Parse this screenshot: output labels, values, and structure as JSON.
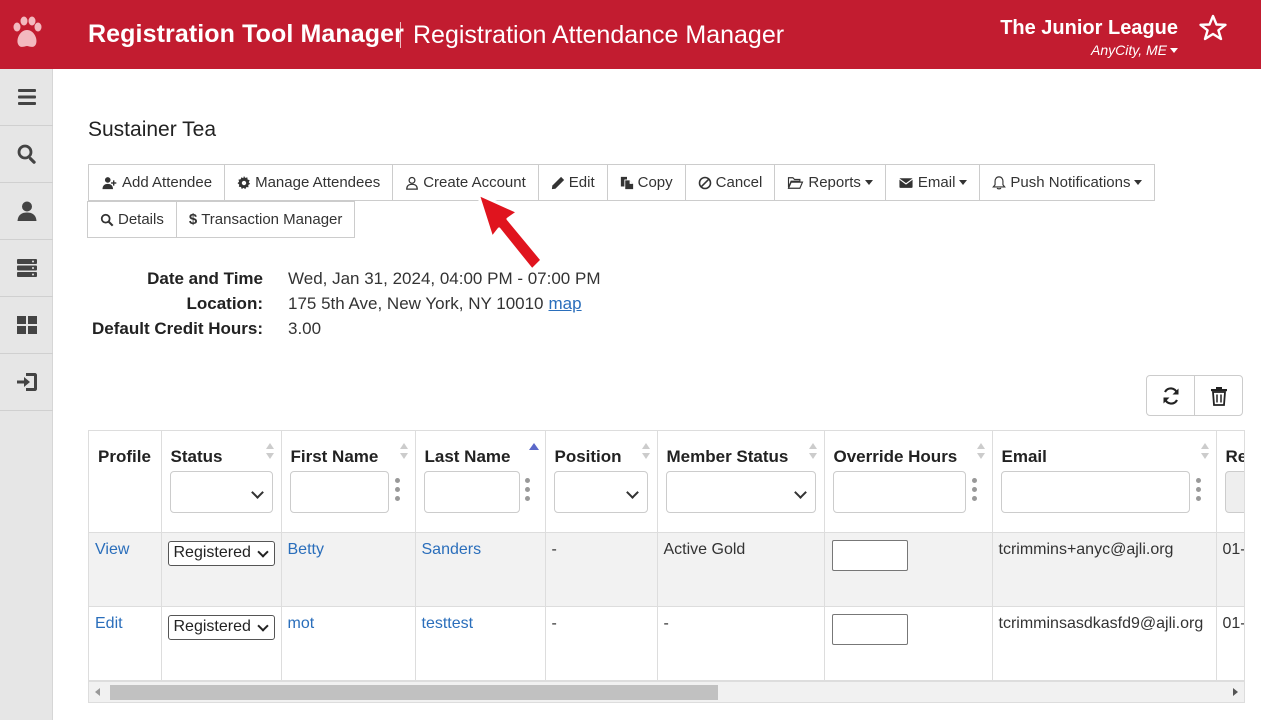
{
  "colors": {
    "brand": "#c21c30",
    "link": "#2a6ebb",
    "sidebar": "#e6e6e6",
    "arrow": "#e0141e"
  },
  "header": {
    "app_title": "Registration Tool Manager",
    "page_title": "Registration Attendance Manager",
    "org_name": "The Junior League",
    "org_city": "AnyCity, ME"
  },
  "sidebar": {
    "items": [
      {
        "icon": "menu-icon"
      },
      {
        "icon": "search-icon"
      },
      {
        "icon": "user-icon"
      },
      {
        "icon": "server-icon"
      },
      {
        "icon": "dashboard-icon"
      },
      {
        "icon": "sign-in-icon"
      }
    ]
  },
  "event": {
    "title": "Sustainer Tea"
  },
  "toolbar": {
    "add_attendee": "Add Attendee",
    "manage_attendees": "Manage Attendees",
    "create_account": "Create Account",
    "edit": "Edit",
    "copy": "Copy",
    "cancel": "Cancel",
    "reports": "Reports",
    "email": "Email",
    "push_notifications": "Push Notifications",
    "details": "Details",
    "transaction_manager": "Transaction Manager"
  },
  "details": {
    "date_label": "Date and Time",
    "date_value": "Wed, Jan 31, 2024, 04:00 PM - 07:00 PM",
    "location_label": "Location:",
    "location_value": "175 5th Ave, New York, NY 10010",
    "map_link": "map",
    "credit_label": "Default Credit Hours:",
    "credit_value": "3.00"
  },
  "table": {
    "headers": {
      "profile": "Profile",
      "status": "Status",
      "first_name": "First Name",
      "last_name": "Last Name",
      "position": "Position",
      "member_status": "Member Status",
      "override_hours": "Override Hours",
      "email": "Email",
      "reg_partial": "Re"
    },
    "rows": [
      {
        "profile": "View",
        "status": "Registered",
        "first_name": "Betty",
        "last_name": "Sanders",
        "position": "-",
        "member_status": "Active Gold",
        "email": "tcrimmins+anyc@ajli.org",
        "reg_partial": "01-"
      },
      {
        "profile": "Edit",
        "status": "Registered",
        "first_name": "mot",
        "last_name": "testtest",
        "position": "-",
        "member_status": "-",
        "email": "tcrimminsasdkasfd9@ajli.org",
        "reg_partial": "01-"
      }
    ]
  }
}
